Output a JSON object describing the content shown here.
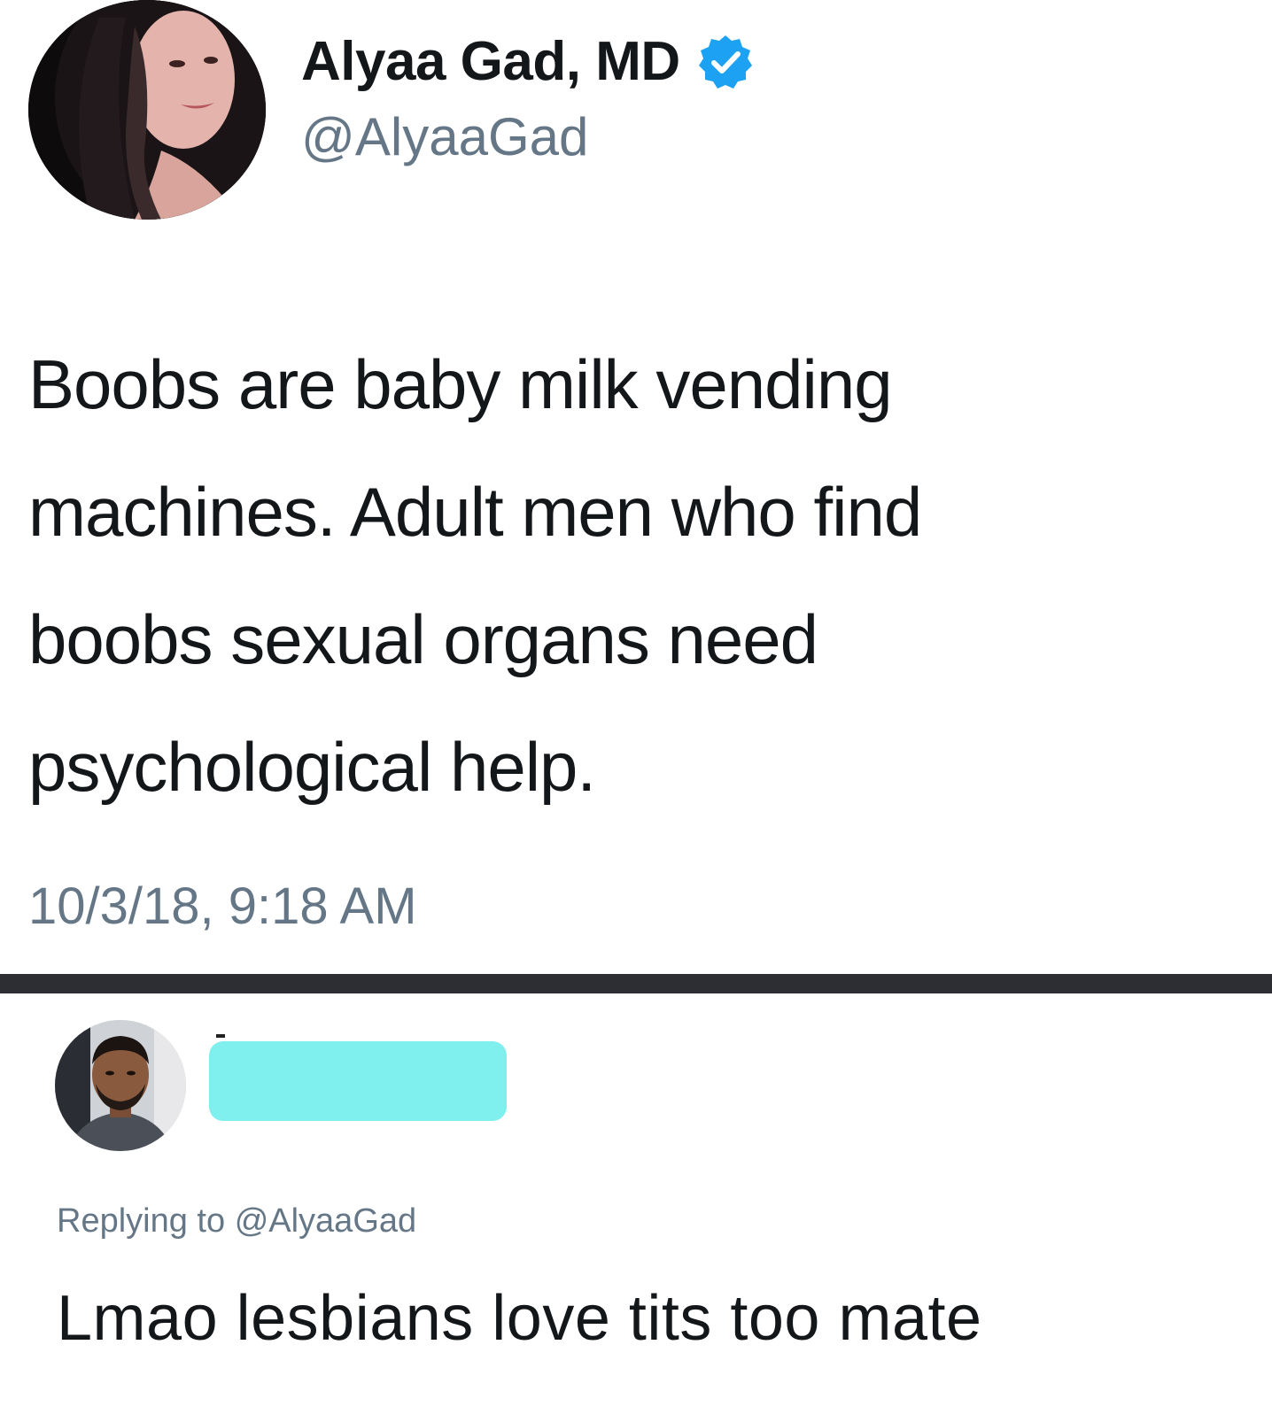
{
  "tweet": {
    "author": {
      "display_name": "Alyaa Gad, MD",
      "handle": "@AlyaaGad",
      "verified": true,
      "avatar": "profile-photo-woman"
    },
    "body_lines": [
      "Boobs are baby milk vending",
      "machines. Adult men who find",
      "boobs sexual organs need",
      "psychological help."
    ],
    "timestamp": "10/3/18, 9:18 AM"
  },
  "reply": {
    "author": {
      "avatar": "profile-photo-man",
      "name_redacted": true
    },
    "replying_label": "Replying to",
    "replying_to": "@AlyaaGad",
    "text": "Lmao lesbians love tits too mate"
  },
  "colors": {
    "text_primary": "#14171a",
    "text_secondary": "#657786",
    "verified_blue": "#1da1f2",
    "divider": "#2c2e33",
    "redaction": "#7ff0ee"
  }
}
